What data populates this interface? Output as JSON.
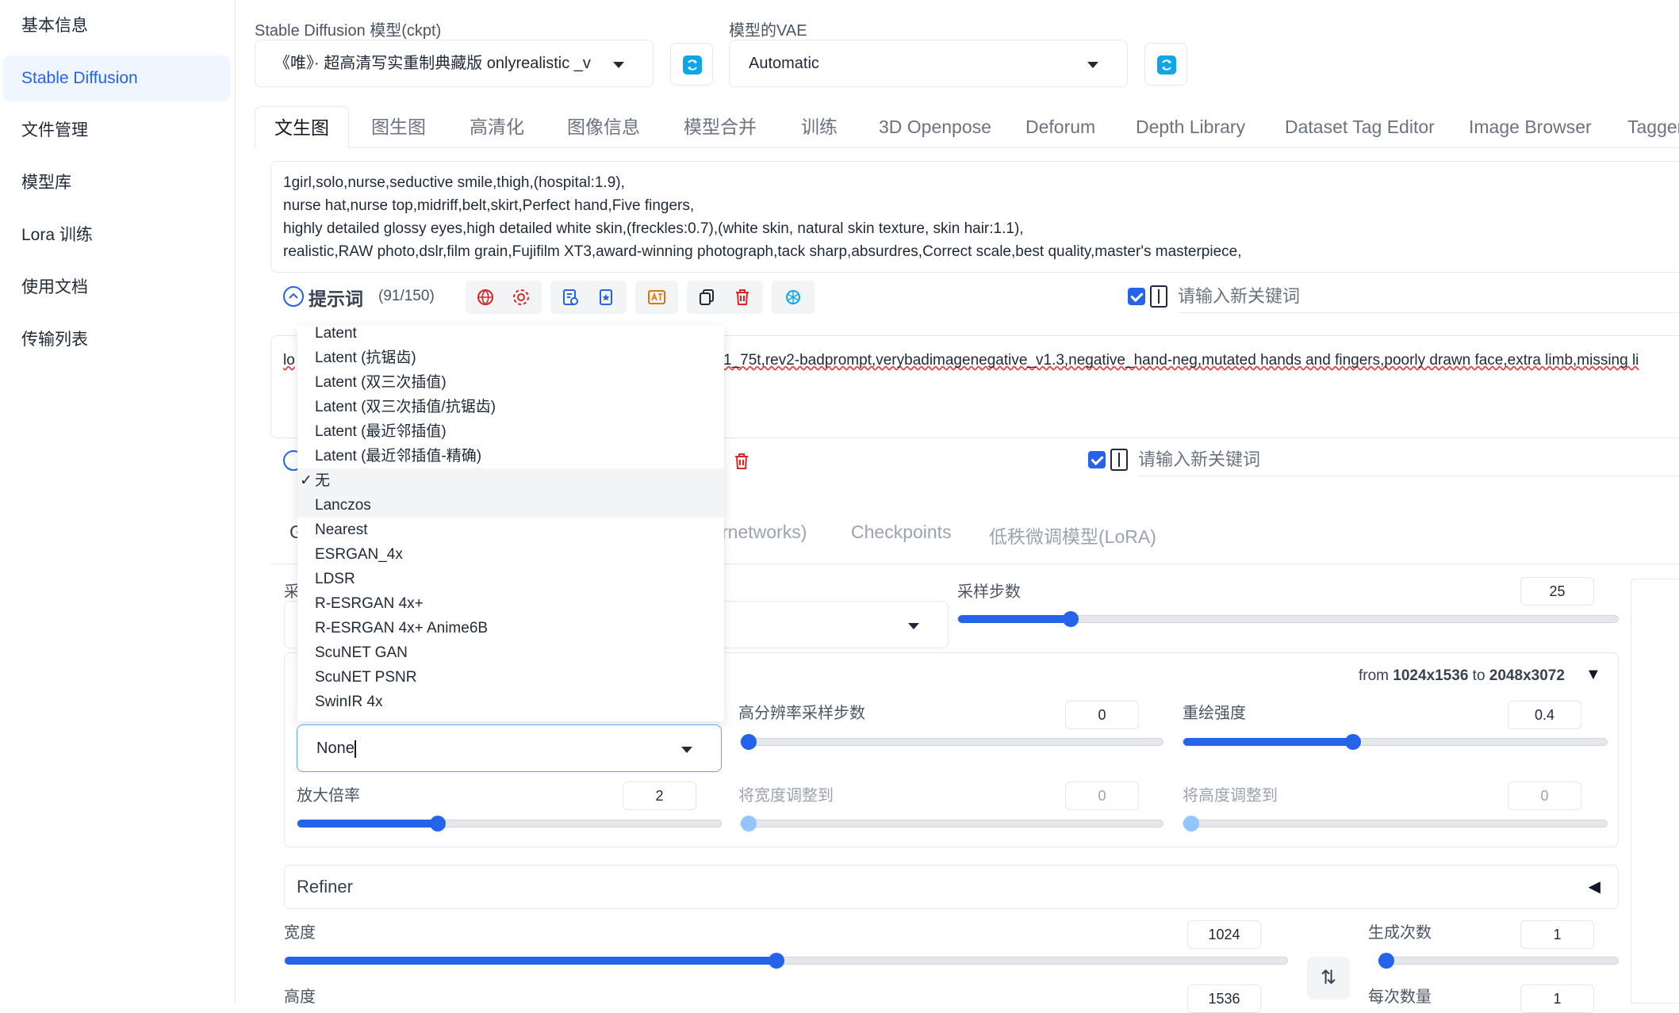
{
  "sidebar": {
    "items": [
      "基本信息",
      "Stable Diffusion",
      "文件管理",
      "模型库",
      "Lora 训练",
      "使用文档",
      "传输列表"
    ],
    "active_index": 1
  },
  "header": {
    "ckpt_label": "Stable Diffusion 模型(ckpt)",
    "ckpt_value": "《唯》· 超高清写实重制典藏版 onlyrealistic _v",
    "vae_label": "模型的VAE",
    "vae_value": "Automatic"
  },
  "tabs": [
    "文生图",
    "图生图",
    "高清化",
    "图像信息",
    "模型合并",
    "训练",
    "3D Openpose",
    "Deforum",
    "Depth Library",
    "Dataset Tag Editor",
    "Image Browser",
    "Tagger"
  ],
  "prompt": {
    "lines": [
      "1girl,solo,nurse,seductive smile,thigh,(hospital:1.9),",
      "nurse hat,nurse top,midriff,belt,skirt,Perfect hand,Five fingers,",
      "highly detailed glossy eyes,high detailed white skin,(freckles:0.7),(white skin, natural skin texture, skin hair:1.1),",
      "realistic,RAW photo,dslr,film grain,Fujifilm XT3,award-winning photograph,tack sharp,absurdres,Correct scale,best quality,master's masterpiece,"
    ],
    "title": "提示词",
    "count": "(91/150)",
    "keyword_placeholder": "请输入新关键词"
  },
  "negative": {
    "text_left": "lo",
    "text_right": "1_75t,rev2-badprompt,verybadimagenegative_v1.3,negative_hand-neg,mutated hands and fingers,poorly drawn face,extra limb,missing li",
    "keyword_placeholder": "请输入新关键词"
  },
  "subtabs": {
    "first_partial": "G",
    "hypernetworks_partial": "rnetworks)",
    "checkpoints": "Checkpoints",
    "lora": "低秩微调模型(LoRA)"
  },
  "sampler": {
    "label_partial": "采",
    "steps_label": "采样步数",
    "steps_value": "25",
    "steps_fraction": 0.17
  },
  "hires": {
    "summary_prefix": "from ",
    "summary_from": "1024x1536",
    "summary_mid": " to ",
    "summary_to": "2048x3072",
    "toggle_glyph": "▼",
    "upscaler_value": "None",
    "steps_label": "高分辨率采样步数",
    "steps_value": "0",
    "steps_fraction": 0.0,
    "denoise_label": "重绘强度",
    "denoise_value": "0.4",
    "denoise_fraction": 0.4,
    "scale_label": "放大倍率",
    "scale_value": "2",
    "scale_fraction": 0.33,
    "resize_w_label": "将宽度调整到",
    "resize_w_value": "0",
    "resize_h_label": "将高度调整到",
    "resize_h_value": "0"
  },
  "upscaler_options": {
    "items": [
      "Latent",
      "Latent (抗锯齿)",
      "Latent (双三次插值)",
      "Latent (双三次插值/抗锯齿)",
      "Latent (最近邻插值)",
      "Latent (最近邻插值-精确)",
      "无",
      "Lanczos",
      "Nearest",
      "ESRGAN_4x",
      "LDSR",
      "R-ESRGAN 4x+",
      "R-ESRGAN 4x+ Anime6B",
      "ScuNET GAN",
      "ScuNET PSNR",
      "SwinIR 4x"
    ],
    "checked_index": 6,
    "hover_index": 7,
    "check_glyph": "✓"
  },
  "refiner": {
    "label": "Refiner",
    "toggle_glyph": "◀"
  },
  "size": {
    "width_label": "宽度",
    "width_value": "1024",
    "width_fraction": 0.49,
    "height_label": "高度",
    "height_value": "1536",
    "swap_glyph": "⇅",
    "batch_count_label": "生成次数",
    "batch_count_value": "1",
    "batch_count_fraction": 0.0,
    "batch_size_label": "每次数量",
    "batch_size_value": "1"
  },
  "colors": {
    "accent": "#2563eb",
    "active_bg": "#eff6ff",
    "refresh_icon": "#0ea5e9",
    "tool_red": "#dc2626",
    "tool_blue": "#2563eb",
    "tool_orange": "#d97706"
  }
}
